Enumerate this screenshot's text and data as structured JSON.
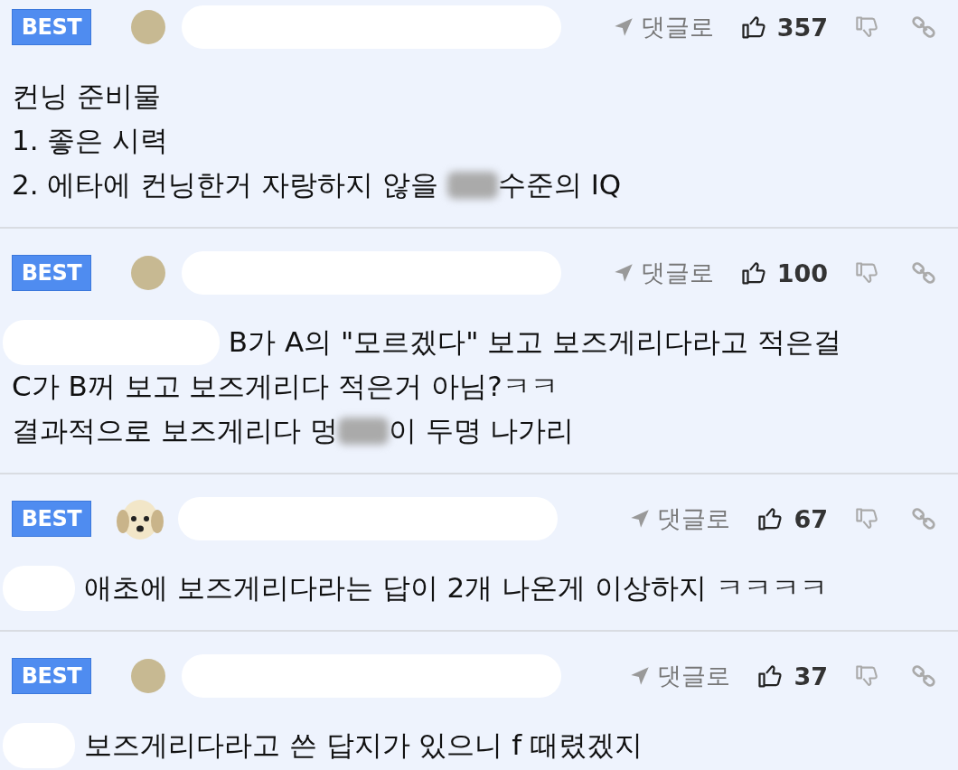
{
  "comments": [
    {
      "badge": "BEST",
      "avatar": {
        "kind": "plain"
      },
      "author_redacted": true,
      "reply_label": "댓글로",
      "likes": "357",
      "lines": [
        [
          {
            "kind": "text",
            "text": "컨닝 준비물"
          }
        ],
        [
          {
            "kind": "text",
            "text": "1. 좋은 시력"
          }
        ],
        [
          {
            "kind": "text",
            "text": "2. 에타에 컨닝한거 자랑하지 않을 "
          },
          {
            "kind": "blur"
          },
          {
            "kind": "text",
            "text": "수준의 IQ"
          }
        ]
      ]
    },
    {
      "badge": "BEST",
      "avatar": {
        "kind": "plain"
      },
      "author_redacted": true,
      "reply_label": "댓글로",
      "likes": "100",
      "lines": [
        [
          {
            "kind": "mask"
          },
          {
            "kind": "text",
            "text": " B가 A의 \"모르겠다\" 보고 보즈게리다라고 적은걸"
          }
        ],
        [
          {
            "kind": "text",
            "text": "C가 B꺼 보고 보즈게리다 적은거 아님?ㅋㅋ"
          }
        ],
        [
          {
            "kind": "text",
            "text": "결과적으로 보즈게리다 멍"
          },
          {
            "kind": "blur"
          },
          {
            "kind": "text",
            "text": "이 두명 나가리"
          }
        ]
      ]
    },
    {
      "badge": "BEST",
      "avatar": {
        "kind": "dog"
      },
      "author_redacted": true,
      "reply_label": "댓글로",
      "likes": "67",
      "lines": [
        [
          {
            "kind": "blot"
          },
          {
            "kind": "text",
            "text": " 애초에 보즈게리다라는 답이 2개 나온게 이상하지 ㅋㅋㅋㅋ"
          }
        ]
      ]
    },
    {
      "badge": "BEST",
      "avatar": {
        "kind": "plain"
      },
      "author_redacted": true,
      "reply_label": "댓글로",
      "likes": "37",
      "lines": [
        [
          {
            "kind": "blot"
          },
          {
            "kind": "text",
            "text": " 보즈게리다라고 쓴 답지가 있으니 f 때렸겠지"
          }
        ]
      ]
    }
  ]
}
